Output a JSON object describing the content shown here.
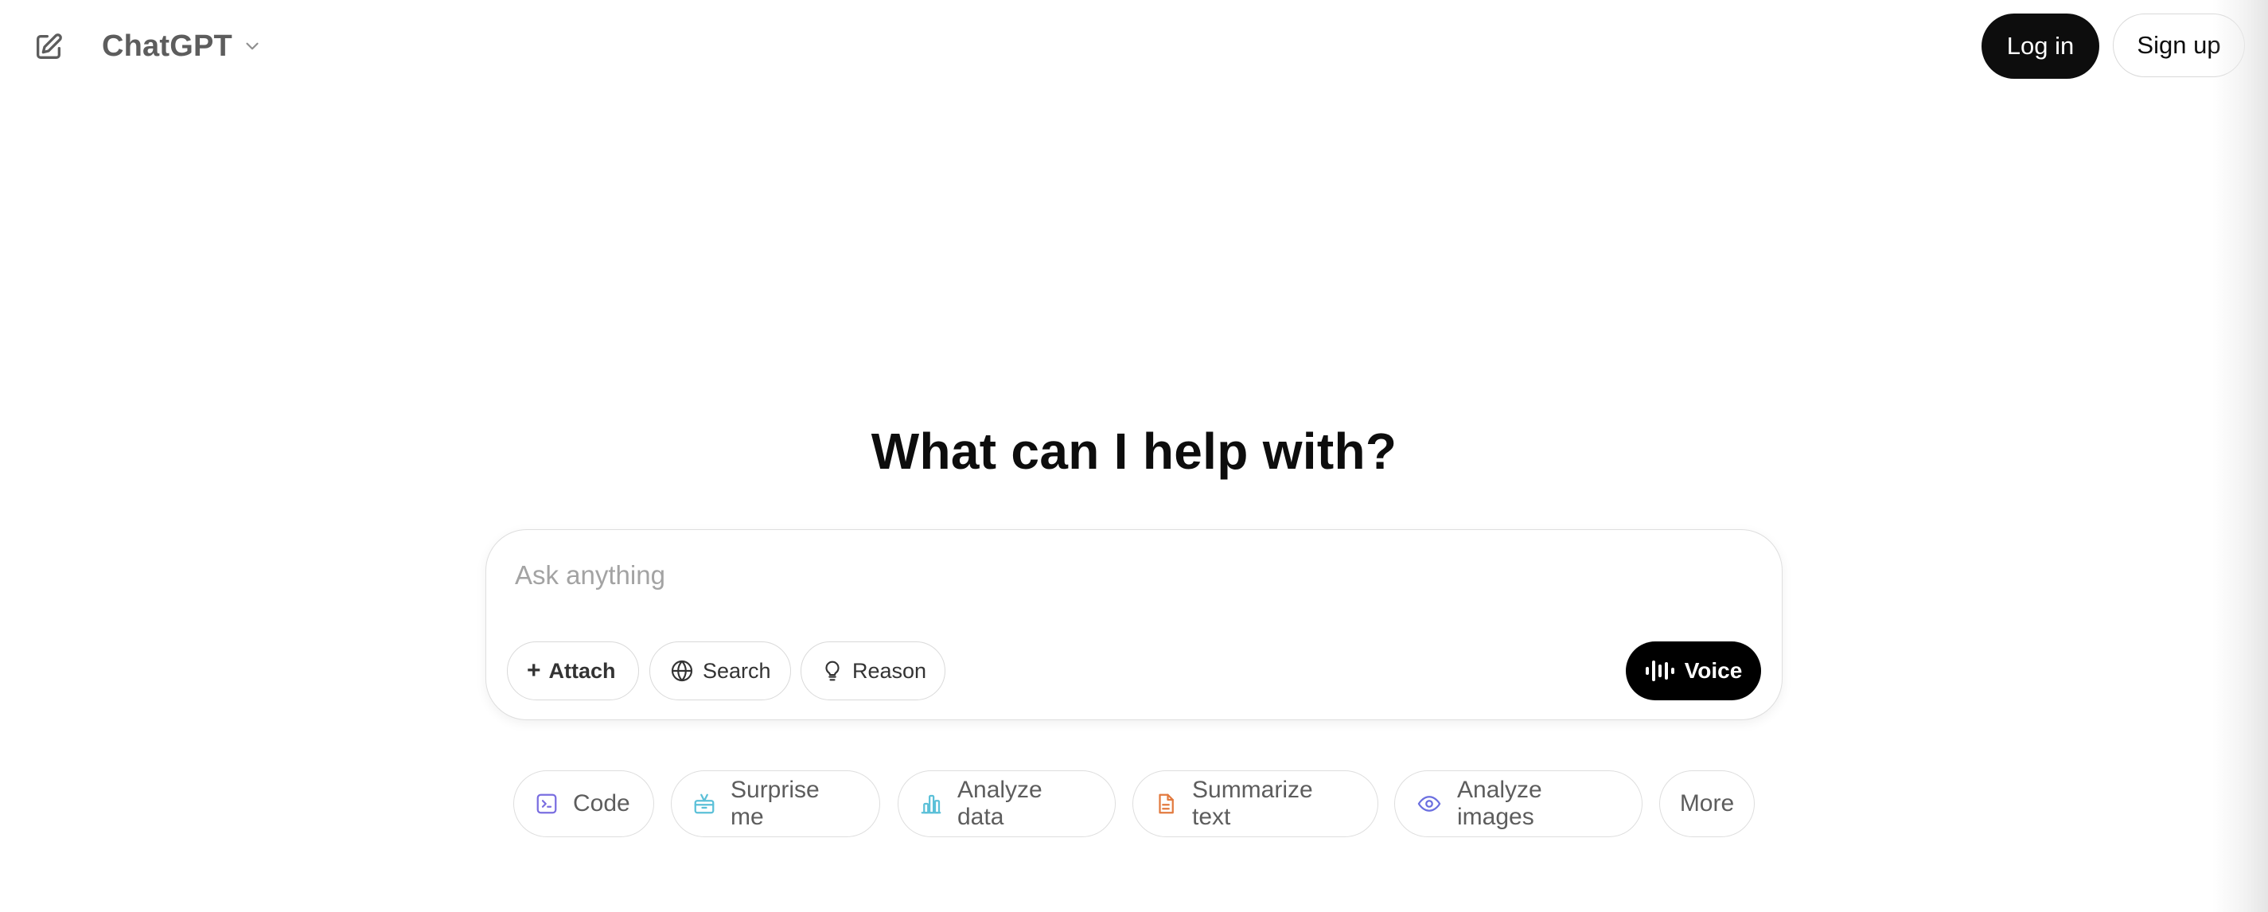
{
  "header": {
    "new_chat_icon": "edit-icon",
    "model_name": "ChatGPT",
    "model_chevron_icon": "chevron-down-icon",
    "login_label": "Log in",
    "signup_label": "Sign up"
  },
  "main": {
    "heading": "What can I help with?"
  },
  "composer": {
    "placeholder": "Ask anything",
    "value": "",
    "tools": [
      {
        "label": "Attach",
        "icon": "plus-icon"
      },
      {
        "label": "Search",
        "icon": "globe-icon"
      },
      {
        "label": "Reason",
        "icon": "lightbulb-icon"
      }
    ],
    "voice_label": "Voice",
    "voice_icon": "voice-waveform-icon"
  },
  "suggestions": [
    {
      "label": "Code",
      "icon": "code-terminal-icon",
      "color": "#7a6ee0"
    },
    {
      "label": "Surprise me",
      "icon": "gift-icon",
      "color": "#5bc0d8"
    },
    {
      "label": "Analyze data",
      "icon": "bar-chart-icon",
      "color": "#5bc0d8"
    },
    {
      "label": "Summarize text",
      "icon": "document-icon",
      "color": "#e27a3f"
    },
    {
      "label": "Analyze images",
      "icon": "eye-icon",
      "color": "#6b6fe0"
    },
    {
      "label": "More"
    }
  ],
  "colors": {
    "primary_button": "#0d0d0d",
    "text_muted": "#5d5d5d",
    "placeholder": "#a3a3a3",
    "border": "#dedede"
  }
}
